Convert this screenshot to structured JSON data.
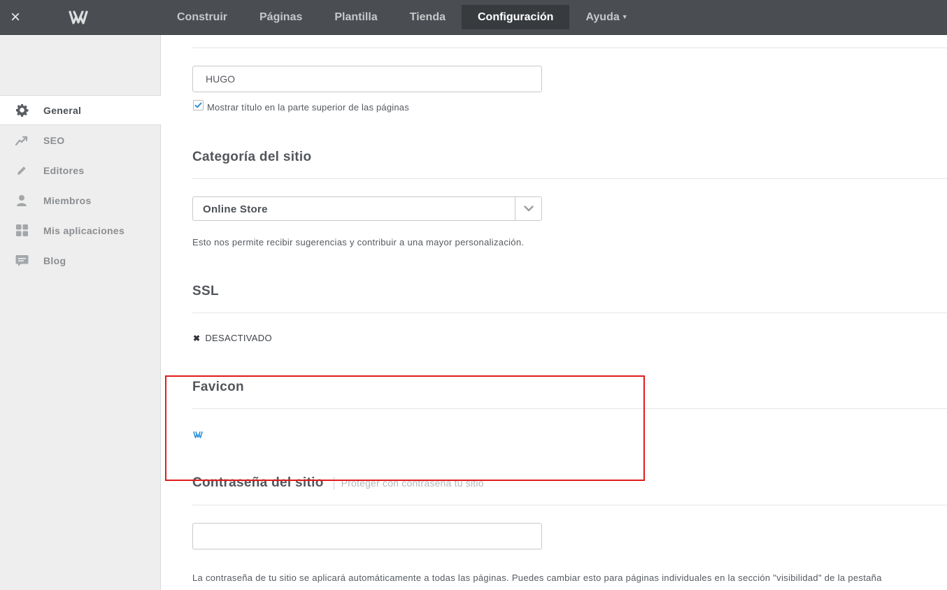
{
  "topbar": {
    "close_icon": "×",
    "logo": "weebly-logo-icon",
    "nav": [
      {
        "label": "Construir",
        "active": false
      },
      {
        "label": "Páginas",
        "active": false
      },
      {
        "label": "Plantilla",
        "active": false
      },
      {
        "label": "Tienda",
        "active": false
      },
      {
        "label": "Configuración",
        "active": true
      },
      {
        "label": "Ayuda",
        "active": false,
        "dropdown": true
      }
    ]
  },
  "sidebar": {
    "items": [
      {
        "label": "General",
        "icon": "gear-icon",
        "active": true
      },
      {
        "label": "SEO",
        "icon": "trend-line-icon",
        "active": false
      },
      {
        "label": "Editores",
        "icon": "pencil-icon",
        "active": false
      },
      {
        "label": "Miembros",
        "icon": "person-icon",
        "active": false
      },
      {
        "label": "Mis aplicaciones",
        "icon": "apps-grid-icon",
        "active": false
      },
      {
        "label": "Blog",
        "icon": "comment-icon",
        "active": false
      }
    ]
  },
  "main": {
    "site_title": {
      "value": "HUGO",
      "show_title_checked": true,
      "show_title_label": "Mostrar título en la parte superior de las páginas"
    },
    "category": {
      "title": "Categoría del sitio",
      "selected": "Online Store",
      "help": "Esto nos permite recibir sugerencias y contribuir a una mayor personalización."
    },
    "ssl": {
      "title": "SSL",
      "status": "DESACTIVADO"
    },
    "favicon": {
      "title": "Favicon",
      "preview_icon": "weebly-favicon-icon"
    },
    "password": {
      "title": "Contraseña del sitio",
      "subtitle": "Proteger con contraseña tu sitio",
      "value": "",
      "help": "La contraseña de tu sitio se aplicará automáticamente a todas las páginas. Puedes cambiar esto para páginas individuales en la sección \"visibilidad\" de la pestaña"
    }
  },
  "colors": {
    "topbar_bg": "#4a4e52",
    "nav_active_bg": "#383b3e",
    "sidebar_bg": "#eeeeee",
    "checkbox_accent": "#2a8fd8",
    "favicon_blue": "#2a8fd8",
    "highlight_red": "#e01b1b"
  }
}
